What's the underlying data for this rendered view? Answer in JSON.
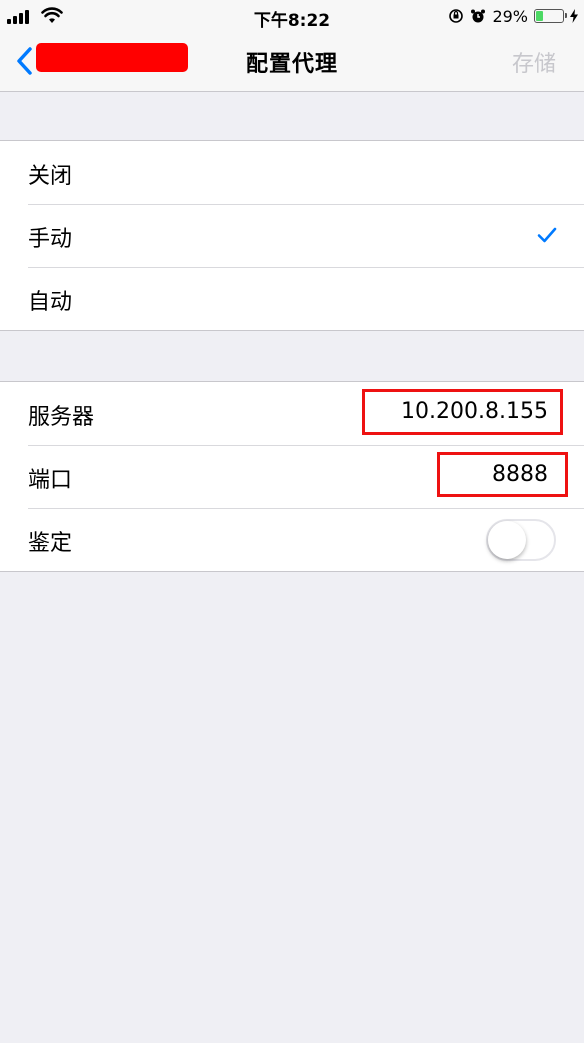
{
  "status_bar": {
    "time": "下午8:22",
    "battery_text": "29%",
    "battery_level": 0.29,
    "icons": [
      "signal-icon",
      "wifi-icon",
      "orientation-lock-icon",
      "alarm-icon",
      "battery-icon",
      "charging-icon"
    ]
  },
  "nav": {
    "title": "配置代理",
    "save_label": "存储",
    "back_icon": "chevron-left-icon",
    "save_color": "#c7c7cc",
    "accent_color": "#007aff"
  },
  "proxy_modes": [
    {
      "label": "关闭",
      "selected": false
    },
    {
      "label": "手动",
      "selected": true
    },
    {
      "label": "自动",
      "selected": false
    }
  ],
  "settings": {
    "server_label": "服务器",
    "server_value": "10.200.8.155",
    "port_label": "端口",
    "port_value": "8888",
    "auth_label": "鉴定",
    "auth_enabled": false
  }
}
